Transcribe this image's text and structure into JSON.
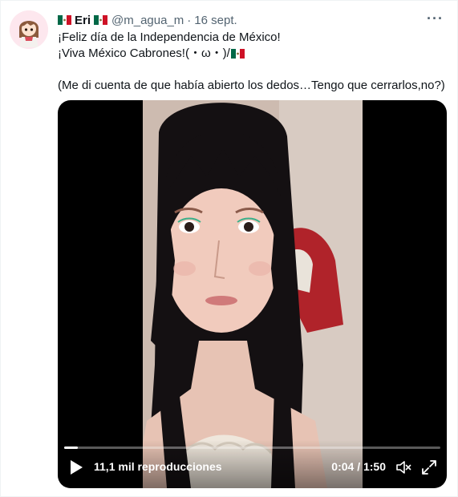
{
  "tweet": {
    "display_name": "Eri",
    "handle": "@m_agua_m",
    "separator": "·",
    "date": "16 sept.",
    "more_icon": "more-icon",
    "text_lines": [
      "¡Feliz día de la Independencia de México!",
      "¡Viva México Cabrones!(・ω・)/"
    ],
    "text_line3": "(Me di cuenta de que había abierto los dedos…Tengo que cerrarlos,no?)"
  },
  "video": {
    "views": "11,1 mil reproducciones",
    "time": "0:04 / 1:50",
    "progress": 0.036,
    "icons": {
      "play": "play-icon",
      "mute": "mute-icon",
      "fullscreen": "fullscreen-icon"
    }
  },
  "colors": {
    "text": "#0f1419",
    "secondary": "#536471",
    "media_bg": "#000000",
    "flag_green": "#006847",
    "flag_red": "#ce1126"
  }
}
